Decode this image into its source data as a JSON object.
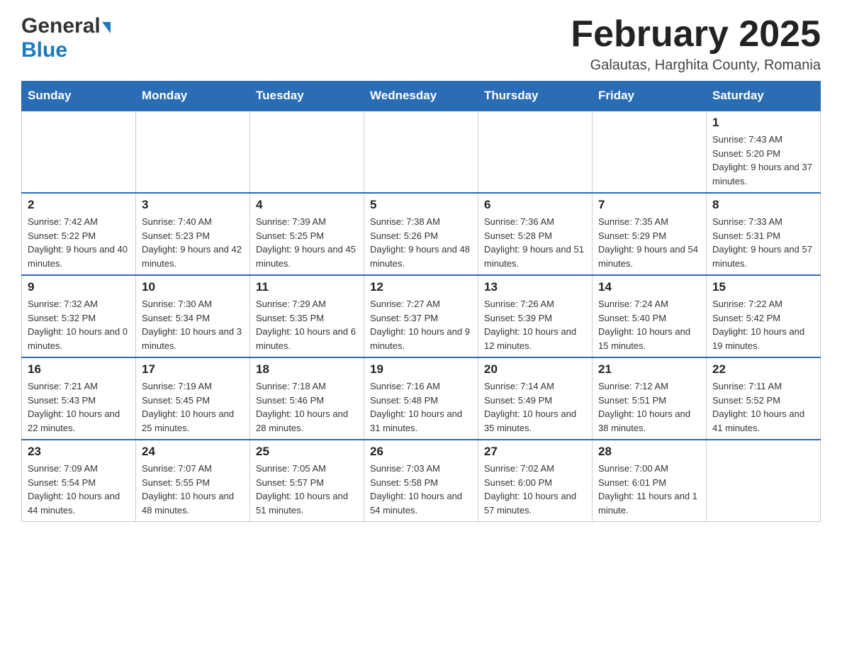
{
  "header": {
    "logo_general": "General",
    "logo_blue": "Blue",
    "title": "February 2025",
    "subtitle": "Galautas, Harghita County, Romania"
  },
  "weekdays": [
    "Sunday",
    "Monday",
    "Tuesday",
    "Wednesday",
    "Thursday",
    "Friday",
    "Saturday"
  ],
  "weeks": [
    [
      {
        "day": "",
        "info": ""
      },
      {
        "day": "",
        "info": ""
      },
      {
        "day": "",
        "info": ""
      },
      {
        "day": "",
        "info": ""
      },
      {
        "day": "",
        "info": ""
      },
      {
        "day": "",
        "info": ""
      },
      {
        "day": "1",
        "info": "Sunrise: 7:43 AM\nSunset: 5:20 PM\nDaylight: 9 hours and 37 minutes."
      }
    ],
    [
      {
        "day": "2",
        "info": "Sunrise: 7:42 AM\nSunset: 5:22 PM\nDaylight: 9 hours and 40 minutes."
      },
      {
        "day": "3",
        "info": "Sunrise: 7:40 AM\nSunset: 5:23 PM\nDaylight: 9 hours and 42 minutes."
      },
      {
        "day": "4",
        "info": "Sunrise: 7:39 AM\nSunset: 5:25 PM\nDaylight: 9 hours and 45 minutes."
      },
      {
        "day": "5",
        "info": "Sunrise: 7:38 AM\nSunset: 5:26 PM\nDaylight: 9 hours and 48 minutes."
      },
      {
        "day": "6",
        "info": "Sunrise: 7:36 AM\nSunset: 5:28 PM\nDaylight: 9 hours and 51 minutes."
      },
      {
        "day": "7",
        "info": "Sunrise: 7:35 AM\nSunset: 5:29 PM\nDaylight: 9 hours and 54 minutes."
      },
      {
        "day": "8",
        "info": "Sunrise: 7:33 AM\nSunset: 5:31 PM\nDaylight: 9 hours and 57 minutes."
      }
    ],
    [
      {
        "day": "9",
        "info": "Sunrise: 7:32 AM\nSunset: 5:32 PM\nDaylight: 10 hours and 0 minutes."
      },
      {
        "day": "10",
        "info": "Sunrise: 7:30 AM\nSunset: 5:34 PM\nDaylight: 10 hours and 3 minutes."
      },
      {
        "day": "11",
        "info": "Sunrise: 7:29 AM\nSunset: 5:35 PM\nDaylight: 10 hours and 6 minutes."
      },
      {
        "day": "12",
        "info": "Sunrise: 7:27 AM\nSunset: 5:37 PM\nDaylight: 10 hours and 9 minutes."
      },
      {
        "day": "13",
        "info": "Sunrise: 7:26 AM\nSunset: 5:39 PM\nDaylight: 10 hours and 12 minutes."
      },
      {
        "day": "14",
        "info": "Sunrise: 7:24 AM\nSunset: 5:40 PM\nDaylight: 10 hours and 15 minutes."
      },
      {
        "day": "15",
        "info": "Sunrise: 7:22 AM\nSunset: 5:42 PM\nDaylight: 10 hours and 19 minutes."
      }
    ],
    [
      {
        "day": "16",
        "info": "Sunrise: 7:21 AM\nSunset: 5:43 PM\nDaylight: 10 hours and 22 minutes."
      },
      {
        "day": "17",
        "info": "Sunrise: 7:19 AM\nSunset: 5:45 PM\nDaylight: 10 hours and 25 minutes."
      },
      {
        "day": "18",
        "info": "Sunrise: 7:18 AM\nSunset: 5:46 PM\nDaylight: 10 hours and 28 minutes."
      },
      {
        "day": "19",
        "info": "Sunrise: 7:16 AM\nSunset: 5:48 PM\nDaylight: 10 hours and 31 minutes."
      },
      {
        "day": "20",
        "info": "Sunrise: 7:14 AM\nSunset: 5:49 PM\nDaylight: 10 hours and 35 minutes."
      },
      {
        "day": "21",
        "info": "Sunrise: 7:12 AM\nSunset: 5:51 PM\nDaylight: 10 hours and 38 minutes."
      },
      {
        "day": "22",
        "info": "Sunrise: 7:11 AM\nSunset: 5:52 PM\nDaylight: 10 hours and 41 minutes."
      }
    ],
    [
      {
        "day": "23",
        "info": "Sunrise: 7:09 AM\nSunset: 5:54 PM\nDaylight: 10 hours and 44 minutes."
      },
      {
        "day": "24",
        "info": "Sunrise: 7:07 AM\nSunset: 5:55 PM\nDaylight: 10 hours and 48 minutes."
      },
      {
        "day": "25",
        "info": "Sunrise: 7:05 AM\nSunset: 5:57 PM\nDaylight: 10 hours and 51 minutes."
      },
      {
        "day": "26",
        "info": "Sunrise: 7:03 AM\nSunset: 5:58 PM\nDaylight: 10 hours and 54 minutes."
      },
      {
        "day": "27",
        "info": "Sunrise: 7:02 AM\nSunset: 6:00 PM\nDaylight: 10 hours and 57 minutes."
      },
      {
        "day": "28",
        "info": "Sunrise: 7:00 AM\nSunset: 6:01 PM\nDaylight: 11 hours and 1 minute."
      },
      {
        "day": "",
        "info": ""
      }
    ]
  ]
}
